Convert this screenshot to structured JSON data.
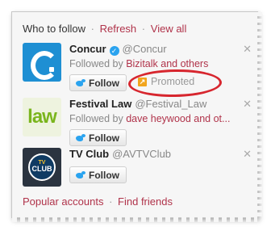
{
  "header": {
    "title": "Who to follow",
    "separator": "·",
    "refresh": "Refresh",
    "view_all": "View all"
  },
  "suggestions": [
    {
      "name": "Concur",
      "verified": true,
      "handle": "@Concur",
      "followed_prefix": "Followed by ",
      "followed_names": "Bizitalk and others",
      "follow_label": "Follow",
      "promoted_label": "Promoted",
      "close_glyph": "✕"
    },
    {
      "name": "Festival Law",
      "handle": "@Festival_Law",
      "avatar_text": "law",
      "followed_prefix": "Followed by ",
      "followed_names": "dave heywood and ot...",
      "follow_label": "Follow",
      "close_glyph": "✕"
    },
    {
      "name": "TV Club",
      "handle": "@AVTVClub",
      "avatar_badge_top": "TV",
      "avatar_badge_text": "CLUB",
      "follow_label": "Follow",
      "close_glyph": "✕"
    }
  ],
  "footer": {
    "popular": "Popular accounts",
    "separator": "·",
    "find_friends": "Find friends"
  },
  "colors": {
    "link": "#b0334a",
    "verified": "#2aa3ef",
    "promoted_icon": "#f1a51d",
    "annotation": "#d7262e"
  }
}
